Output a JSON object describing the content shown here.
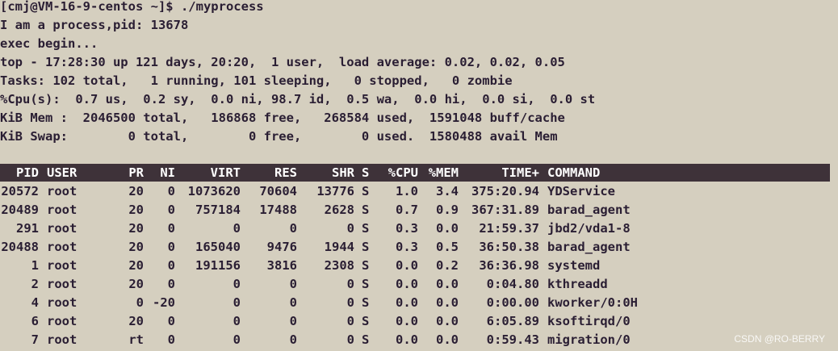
{
  "terminal": {
    "prompt_line": "[cmj@VM-16-9-centos ~]$ ./myprocess",
    "output": [
      "I am a process,pid: 13678",
      "exec begin..."
    ],
    "summary": [
      "top - 17:28:30 up 121 days, 20:20,  1 user,  load average: 0.02, 0.02, 0.05",
      "Tasks: 102 total,   1 running, 101 sleeping,   0 stopped,   0 zombie",
      "%Cpu(s):  0.7 us,  0.2 sy,  0.0 ni, 98.7 id,  0.5 wa,  0.0 hi,  0.0 si,  0.0 st",
      "KiB Mem :  2046500 total,   186868 free,   268584 used,  1591048 buff/cache",
      "KiB Swap:        0 total,        0 free,        0 used.  1580488 avail Mem"
    ]
  },
  "table": {
    "headers": [
      "PID",
      "USER",
      "PR",
      "NI",
      "VIRT",
      "RES",
      "SHR",
      "S",
      "%CPU",
      "%MEM",
      "TIME+",
      "COMMAND"
    ],
    "rows": [
      [
        "20572",
        "root",
        "20",
        "0",
        "1073620",
        "70604",
        "13776",
        "S",
        "1.0",
        "3.4",
        "375:20.94",
        "YDService"
      ],
      [
        "20489",
        "root",
        "20",
        "0",
        "757184",
        "17488",
        "2628",
        "S",
        "0.7",
        "0.9",
        "367:31.89",
        "barad_agent"
      ],
      [
        "291",
        "root",
        "20",
        "0",
        "0",
        "0",
        "0",
        "S",
        "0.3",
        "0.0",
        "21:59.37",
        "jbd2/vda1-8"
      ],
      [
        "20488",
        "root",
        "20",
        "0",
        "165040",
        "9476",
        "1944",
        "S",
        "0.3",
        "0.5",
        "36:50.38",
        "barad_agent"
      ],
      [
        "1",
        "root",
        "20",
        "0",
        "191156",
        "3816",
        "2308",
        "S",
        "0.0",
        "0.2",
        "36:36.98",
        "systemd"
      ],
      [
        "2",
        "root",
        "20",
        "0",
        "0",
        "0",
        "0",
        "S",
        "0.0",
        "0.0",
        "0:04.80",
        "kthreadd"
      ],
      [
        "4",
        "root",
        "0",
        "-20",
        "0",
        "0",
        "0",
        "S",
        "0.0",
        "0.0",
        "0:00.00",
        "kworker/0:0H"
      ],
      [
        "6",
        "root",
        "20",
        "0",
        "0",
        "0",
        "0",
        "S",
        "0.0",
        "0.0",
        "6:05.89",
        "ksoftirqd/0"
      ],
      [
        "7",
        "root",
        "rt",
        "0",
        "0",
        "0",
        "0",
        "S",
        "0.0",
        "0.0",
        "0:59.43",
        "migration/0"
      ]
    ]
  },
  "watermark": "CSDN @RO-BERRY",
  "colors": {
    "background": "#d5cfbf",
    "text": "#2a1e33",
    "header_bar": "#3e3239",
    "header_text": "#ffffff"
  }
}
